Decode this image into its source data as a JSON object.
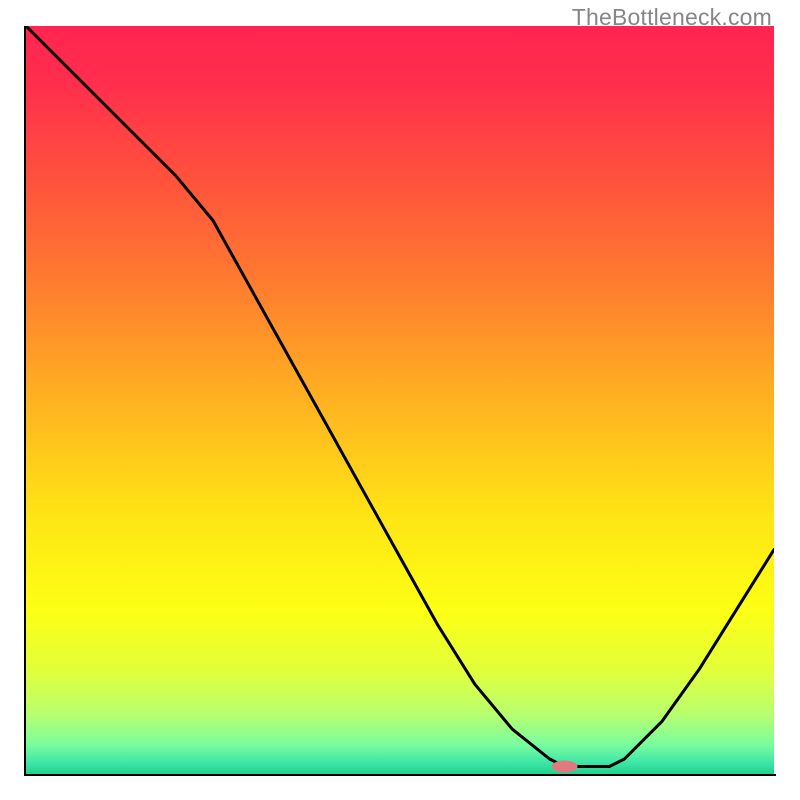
{
  "watermark": "TheBottleneck.com",
  "chart_data": {
    "type": "line",
    "title": "",
    "xlabel": "",
    "ylabel": "",
    "xlim": [
      0,
      100
    ],
    "ylim": [
      0,
      100
    ],
    "series": [
      {
        "name": "bottleneck-curve",
        "x": [
          0,
          5,
          10,
          15,
          20,
          25,
          30,
          35,
          40,
          45,
          50,
          55,
          60,
          65,
          70,
          72,
          75,
          78,
          80,
          85,
          90,
          95,
          100
        ],
        "y": [
          100,
          95,
          90,
          85,
          80,
          74,
          65,
          56,
          47,
          38,
          29,
          20,
          12,
          6,
          2,
          1,
          1,
          1,
          2,
          7,
          14,
          22,
          30
        ],
        "color": "#000000",
        "width": 3
      }
    ],
    "marker": {
      "x": 72,
      "y": 1,
      "color": "#e17a7e",
      "rx": 13,
      "ry": 6
    },
    "background_gradient": {
      "stops": [
        {
          "offset": 0.0,
          "color": "#ff2451"
        },
        {
          "offset": 0.08,
          "color": "#ff2f4c"
        },
        {
          "offset": 0.2,
          "color": "#ff503d"
        },
        {
          "offset": 0.35,
          "color": "#ff7e2f"
        },
        {
          "offset": 0.5,
          "color": "#ffb221"
        },
        {
          "offset": 0.65,
          "color": "#ffe315"
        },
        {
          "offset": 0.78,
          "color": "#fdff14"
        },
        {
          "offset": 0.86,
          "color": "#e3ff3a"
        },
        {
          "offset": 0.92,
          "color": "#b8ff6e"
        },
        {
          "offset": 0.96,
          "color": "#7bfd9e"
        },
        {
          "offset": 0.985,
          "color": "#3ee6a7"
        },
        {
          "offset": 1.0,
          "color": "#1fd08f"
        }
      ]
    }
  }
}
